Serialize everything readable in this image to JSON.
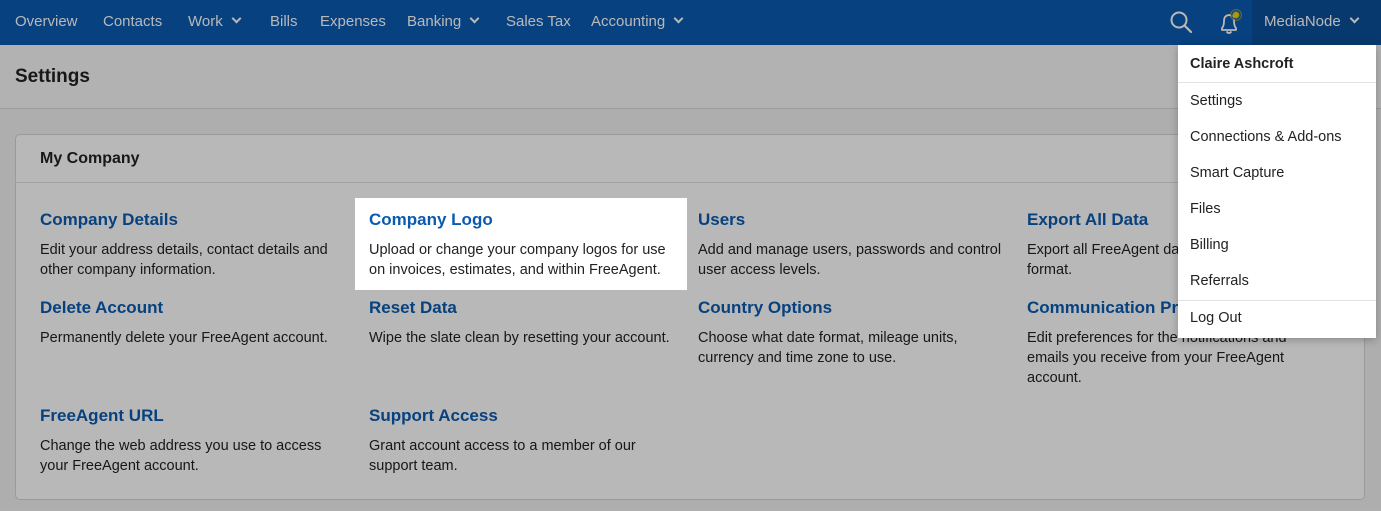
{
  "nav": {
    "items": [
      {
        "label": "Overview",
        "has_menu": false
      },
      {
        "label": "Contacts",
        "has_menu": false
      },
      {
        "label": "Work",
        "has_menu": true
      },
      {
        "label": "Bills",
        "has_menu": false
      },
      {
        "label": "Expenses",
        "has_menu": false
      },
      {
        "label": "Banking",
        "has_menu": true
      },
      {
        "label": "Sales Tax",
        "has_menu": false
      },
      {
        "label": "Accounting",
        "has_menu": true
      }
    ],
    "account_label": "MediaNode",
    "icons": {
      "search": "search-icon",
      "notifications": "bell-icon",
      "notification_dot_color": "#f5d20a"
    },
    "brand_color": "#0a5bb0"
  },
  "page": {
    "title": "Settings"
  },
  "panel": {
    "title": "My Company",
    "settings": [
      {
        "title": "Company Details",
        "description": "Edit your address details, contact details and other company information."
      },
      {
        "title": "Company Logo",
        "description": "Upload or change your company logos for use on invoices, estimates, and within FreeAgent."
      },
      {
        "title": "Users",
        "description": "Add and manage users, passwords and control user access levels."
      },
      {
        "title": "Export All Data",
        "description": "Export all FreeAgent data to Excel (XLSX) format."
      },
      {
        "title": "Delete Account",
        "description": "Permanently delete your FreeAgent account."
      },
      {
        "title": "Reset Data",
        "description": "Wipe the slate clean by resetting your account."
      },
      {
        "title": "Country Options",
        "description": "Choose what date format, mileage units, currency and time zone to use."
      },
      {
        "title": "Communication Preferences",
        "description": "Edit preferences for the notifications and emails you receive from your FreeAgent account."
      },
      {
        "title": "FreeAgent URL",
        "description": "Change the web address you use to access your FreeAgent account."
      },
      {
        "title": "Support Access",
        "description": "Grant account access to a member of our support team."
      }
    ]
  },
  "account_dropdown": {
    "user_name": "Claire Ashcroft",
    "items": [
      "Settings",
      "Connections & Add-ons",
      "Smart Capture",
      "Files",
      "Billing",
      "Referrals"
    ],
    "logout": "Log Out"
  }
}
